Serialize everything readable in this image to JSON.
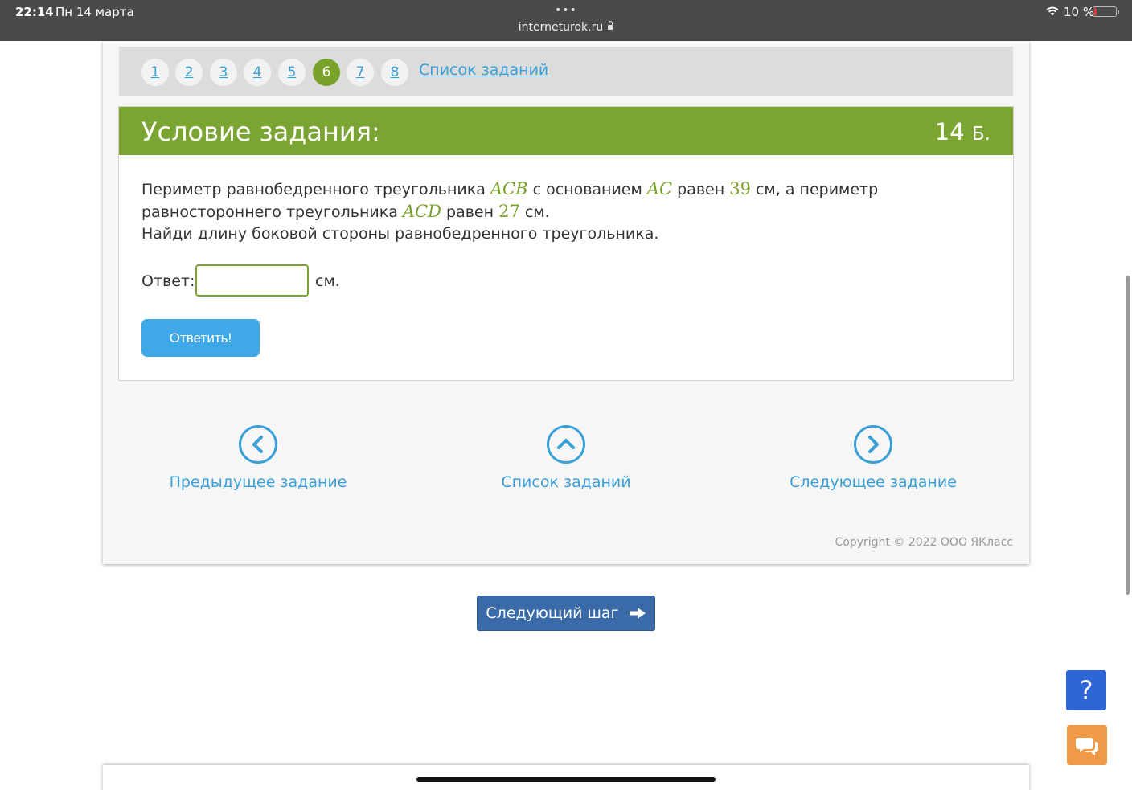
{
  "status_bar": {
    "time": "22:14",
    "date": "Пн 14 марта",
    "dots": "•••",
    "url": "interneturok.ru",
    "battery": "10 %"
  },
  "pager": {
    "pages": [
      "1",
      "2",
      "3",
      "4",
      "5",
      "6",
      "7",
      "8"
    ],
    "active_page": "6",
    "list_link": "Список заданий"
  },
  "task": {
    "title": "Условие задания:",
    "points_value": "14",
    "points_unit": "Б.",
    "text": {
      "p1": "Периметр равнобедренного треугольника ",
      "m1": "ACB",
      "p2": " с основанием ",
      "m2": "AC",
      "p3": " равен ",
      "n1": "39",
      "p4": " см, а периметр равностороннего треугольника ",
      "m3": "ACD",
      "p5": " равен ",
      "n2": "27",
      "p6": " см.",
      "line2": "Найди длину боковой стороны равнобедренного треугольника."
    },
    "answer_label": "Ответ:",
    "answer_value": "",
    "answer_unit": "см.",
    "submit_label": "Ответить!"
  },
  "navigation": {
    "prev": "Предыдущее задание",
    "list": "Список заданий",
    "next": "Следующее задание"
  },
  "copyright": "Copyright © 2022 ООО ЯКласс",
  "next_step": "Следующий шаг",
  "help": "?",
  "colors": {
    "accent_green": "#7aa532",
    "link_blue": "#3a9fd8",
    "button_blue": "#3fa9e8",
    "next_step_blue": "#3a6aa7",
    "help_blue": "#2e66d8",
    "chat_orange": "#ef9a46"
  }
}
